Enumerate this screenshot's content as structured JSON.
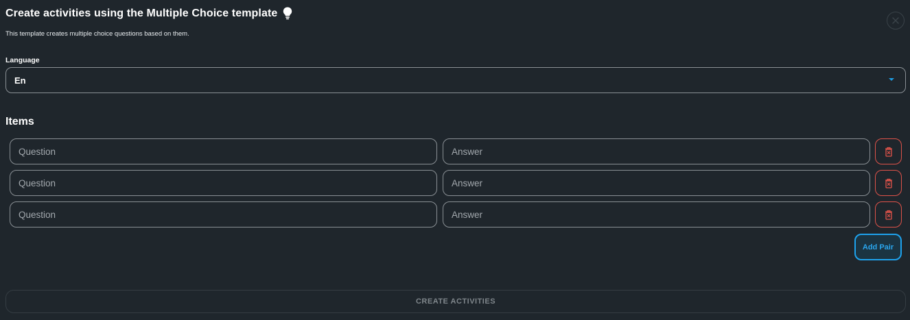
{
  "header": {
    "title": "Create activities using the Multiple Choice template",
    "subtitle": "This template creates multiple choice questions based on them."
  },
  "language": {
    "label": "Language",
    "selected": "En"
  },
  "items": {
    "heading": "Items",
    "rows": [
      {
        "question_placeholder": "Question",
        "answer_placeholder": "Answer",
        "question_value": "",
        "answer_value": ""
      },
      {
        "question_placeholder": "Question",
        "answer_placeholder": "Answer",
        "question_value": "",
        "answer_value": ""
      },
      {
        "question_placeholder": "Question",
        "answer_placeholder": "Answer",
        "question_value": "",
        "answer_value": ""
      }
    ],
    "add_pair_label": "Add Pair"
  },
  "footer": {
    "create_label": "CREATE ACTIVITIES"
  },
  "colors": {
    "background": "#1f262c",
    "accent": "#1ea3ee",
    "danger": "#e0534a"
  },
  "icons": {
    "title": "lightbulb-icon",
    "close": "close-icon",
    "dropdown": "caret-down-icon",
    "delete": "trash-icon"
  }
}
